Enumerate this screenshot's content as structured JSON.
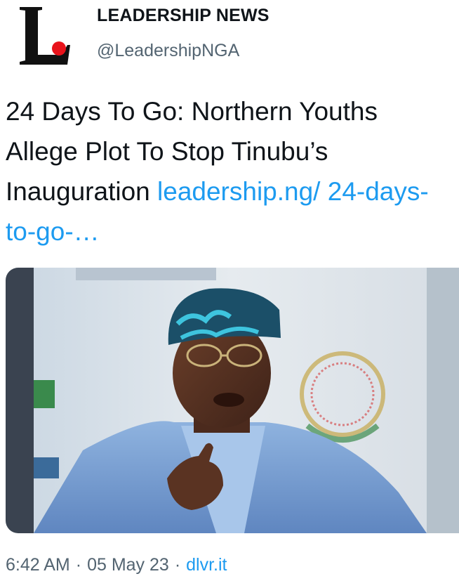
{
  "tweet": {
    "author": {
      "display_name": "LEADERSHIP NEWS",
      "handle": "@LeadershipNGA",
      "logo_letter": "L",
      "logo_colors": {
        "letter": "#111111",
        "dot": "#e8131b"
      }
    },
    "text": "24 Days To Go: Northern Youths Allege Plot To Stop Tinubu’s Inauguration",
    "link": "leadership.ng/ 24-days-to-go-…",
    "media": {
      "icon": "photo-of-speaker"
    },
    "time": "6:42 AM",
    "separator": "·",
    "date": "05 May 23",
    "source": "dlvr.it"
  },
  "colors": {
    "link": "#1d9bf0",
    "secondary_text": "#536471",
    "primary_text": "#0f1419"
  }
}
